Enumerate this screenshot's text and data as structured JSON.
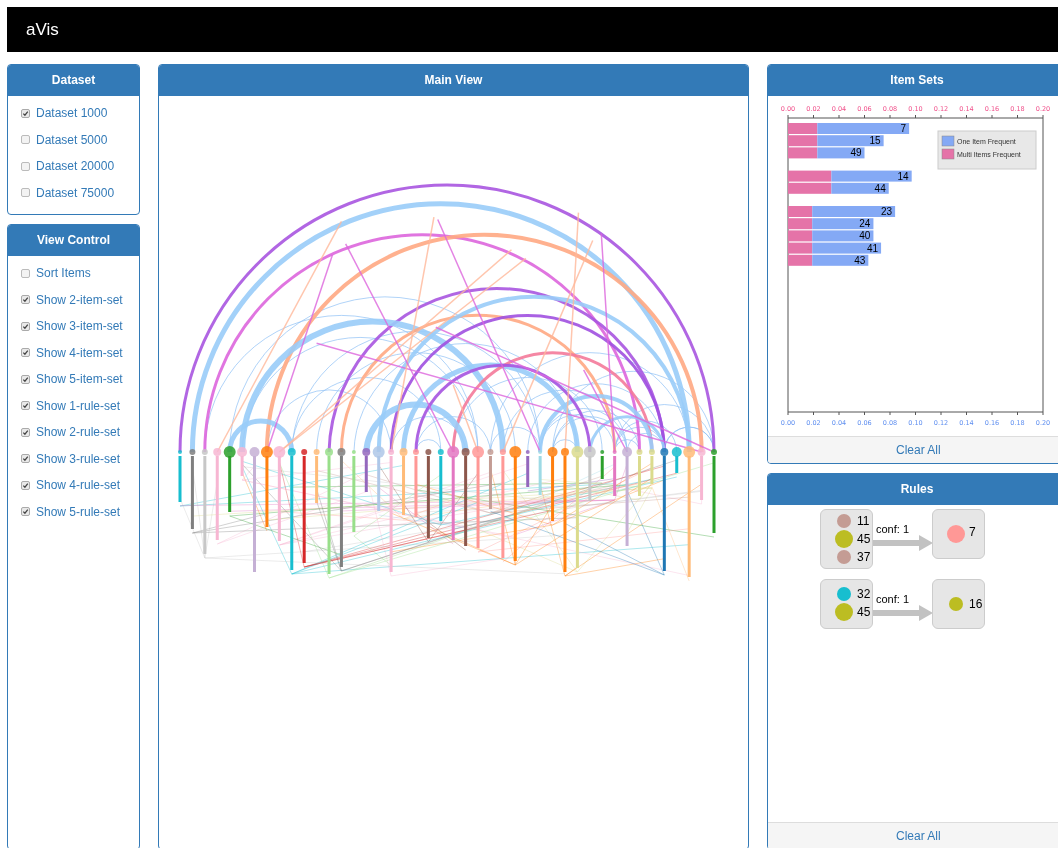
{
  "app": {
    "title": "aVis"
  },
  "dataset_panel": {
    "title": "Dataset",
    "options": [
      {
        "label": "Dataset 1000",
        "checked": true
      },
      {
        "label": "Dataset 5000",
        "checked": false
      },
      {
        "label": "Dataset 20000",
        "checked": false
      },
      {
        "label": "Dataset 75000",
        "checked": false
      }
    ]
  },
  "view_control_panel": {
    "title": "View Control",
    "options": [
      {
        "label": "Sort Items",
        "checked": false
      },
      {
        "label": "Show 2-item-set",
        "checked": true
      },
      {
        "label": "Show 3-item-set",
        "checked": true
      },
      {
        "label": "Show 4-item-set",
        "checked": true
      },
      {
        "label": "Show 5-item-set",
        "checked": true
      },
      {
        "label": "Show 1-rule-set",
        "checked": true
      },
      {
        "label": "Show 2-rule-set",
        "checked": true
      },
      {
        "label": "Show 3-rule-set",
        "checked": true
      },
      {
        "label": "Show 4-rule-set",
        "checked": true
      },
      {
        "label": "Show 5-rule-set",
        "checked": true
      }
    ]
  },
  "main_view": {
    "title": "Main View"
  },
  "item_sets_panel": {
    "title": "Item Sets",
    "footer_button": "Clear All",
    "chart_data": {
      "type": "bar",
      "orientation": "horizontal",
      "stacked": true,
      "legend": true,
      "categories": [
        "7",
        "15",
        "49",
        null,
        "14",
        "44",
        null,
        "23",
        "24",
        "40",
        "41",
        "43"
      ],
      "series": [
        {
          "name": "Multi Items Frequent",
          "color": "#e573a8",
          "values": [
            0.023,
            0.023,
            0.023,
            null,
            0.034,
            0.034,
            null,
            0.019,
            0.019,
            0.019,
            0.019,
            0.019
          ]
        },
        {
          "name": "One Item Frequent",
          "color": "#84a9f5",
          "values": [
            0.072,
            0.052,
            0.037,
            null,
            0.063,
            0.045,
            null,
            0.065,
            0.048,
            0.048,
            0.054,
            0.044
          ]
        }
      ],
      "xlim": [
        0,
        0.2
      ],
      "xticks": [
        {
          "value": 0,
          "label": "0.00"
        },
        {
          "value": 0.02,
          "label": "0.02"
        },
        {
          "value": 0.04,
          "label": "0.04"
        },
        {
          "value": 0.06,
          "label": "0.06"
        },
        {
          "value": 0.08,
          "label": "0.08"
        },
        {
          "value": 0.1,
          "label": "0.10"
        },
        {
          "value": 0.12,
          "label": "0.12"
        },
        {
          "value": 0.14,
          "label": "0.14"
        },
        {
          "value": 0.16,
          "label": "0.16"
        },
        {
          "value": 0.18,
          "label": "0.18"
        },
        {
          "value": 0.2,
          "label": "0.20"
        }
      ]
    }
  },
  "rules_panel": {
    "title": "Rules",
    "footer_button": "Clear All",
    "rules": [
      {
        "antecedent": [
          {
            "label": "11",
            "color": "#c49c94",
            "kind": "small"
          },
          {
            "label": "45",
            "color": "#bcbd22",
            "kind": "large"
          },
          {
            "label": "37",
            "color": "#c49c94",
            "kind": "small"
          }
        ],
        "confidence": "conf: 1",
        "consequent": [
          {
            "label": "7",
            "color": "#ff9896",
            "kind": "large"
          }
        ]
      },
      {
        "antecedent": [
          {
            "label": "32",
            "color": "#17becf",
            "kind": "small"
          },
          {
            "label": "45",
            "color": "#bcbd22",
            "kind": "large"
          }
        ],
        "confidence": "conf: 1",
        "consequent": [
          {
            "label": "16",
            "color": "#bcbd22",
            "kind": "small"
          }
        ]
      }
    ]
  }
}
